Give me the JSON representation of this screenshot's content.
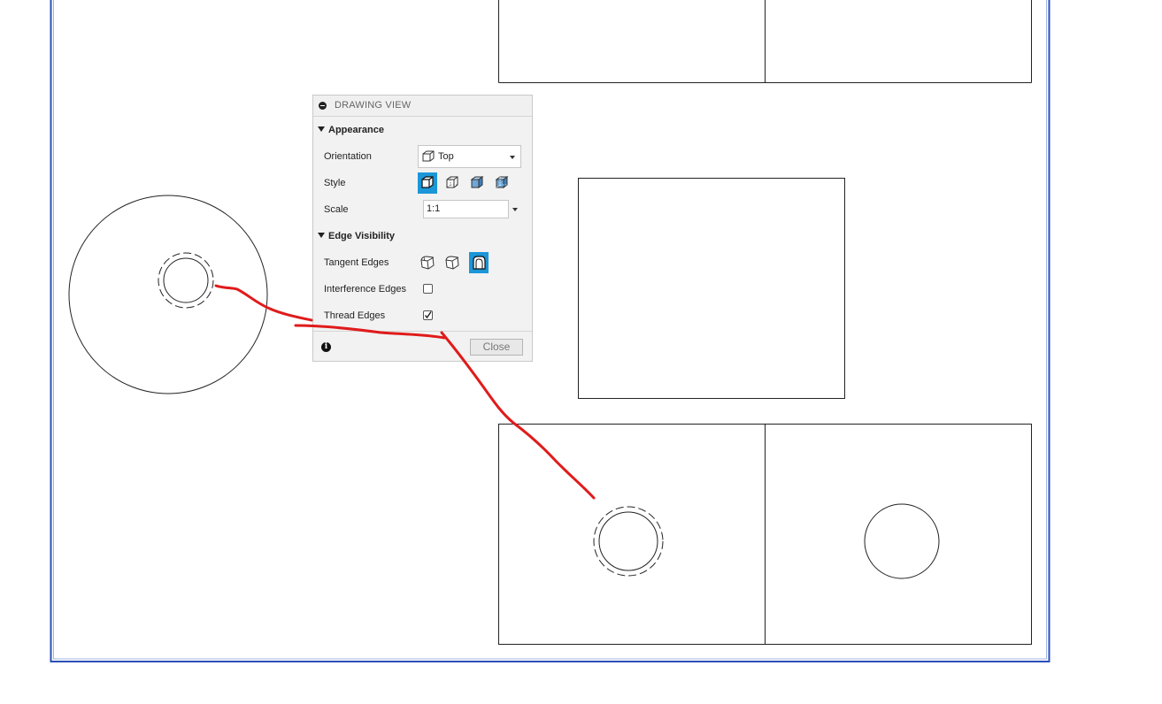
{
  "panel": {
    "title": "DRAWING VIEW",
    "appearance": {
      "header": "Appearance",
      "orientation_label": "Orientation",
      "orientation_value": "Top",
      "style_label": "Style",
      "style_options": [
        "visible-edges-icon",
        "visible-and-hidden-edges-icon",
        "shaded-icon",
        "shaded-hidden-edges-icon"
      ],
      "style_selected": 0,
      "scale_label": "Scale",
      "scale_value": "1:1"
    },
    "edge_visibility": {
      "header": "Edge Visibility",
      "tangent_label": "Tangent Edges",
      "tangent_options": [
        "tangent-full-length-icon",
        "tangent-shortened-icon",
        "tangent-off-icon"
      ],
      "tangent_selected": 2,
      "interference_label": "Interference Edges",
      "interference_checked": false,
      "thread_label": "Thread Edges",
      "thread_checked": true
    },
    "close_label": "Close"
  },
  "colors": {
    "sheet_border": "#2b4fb7",
    "active_button": "#1b96d8",
    "annotation": "#e01b1b"
  }
}
